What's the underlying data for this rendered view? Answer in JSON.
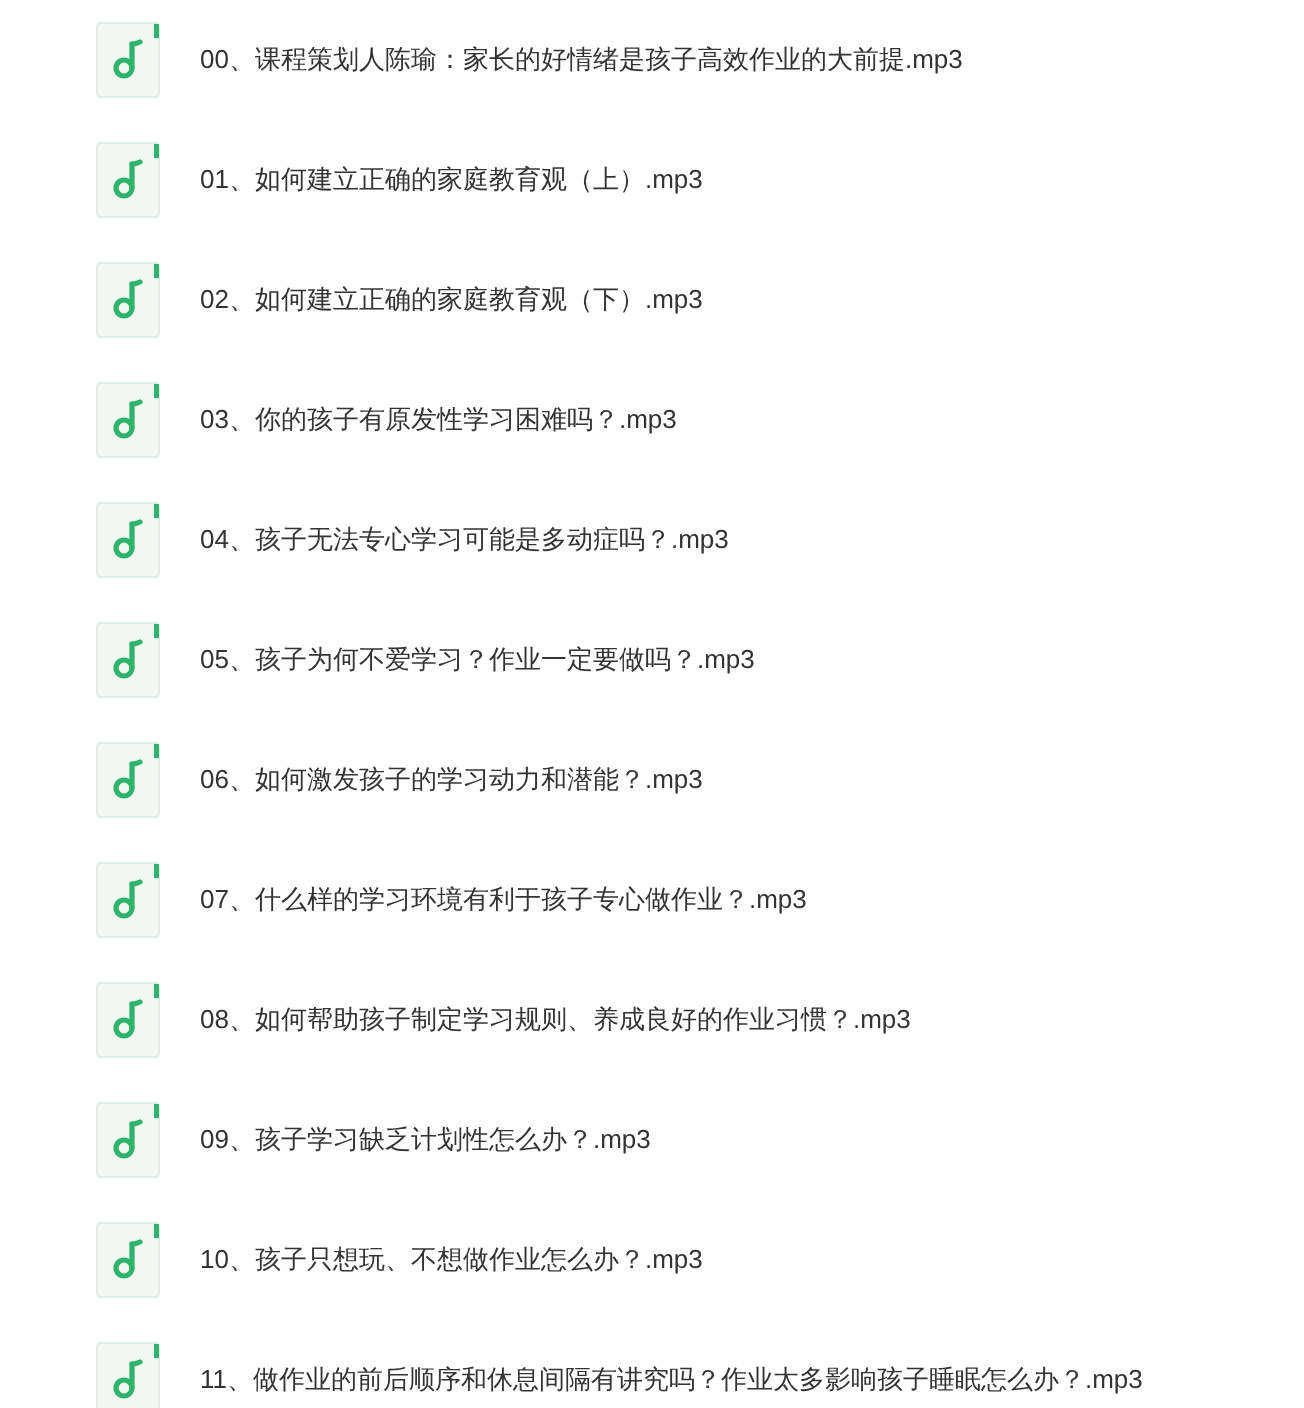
{
  "files": [
    {
      "name": "00、课程策划人陈瑜：家长的好情绪是孩子高效作业的大前提.mp3"
    },
    {
      "name": "01、如何建立正确的家庭教育观（上）.mp3"
    },
    {
      "name": "02、如何建立正确的家庭教育观（下）.mp3"
    },
    {
      "name": "03、你的孩子有原发性学习困难吗？.mp3"
    },
    {
      "name": "04、孩子无法专心学习可能是多动症吗？.mp3"
    },
    {
      "name": "05、孩子为何不爱学习？作业一定要做吗？.mp3"
    },
    {
      "name": "06、如何激发孩子的学习动力和潜能？.mp3"
    },
    {
      "name": "07、什么样的学习环境有利于孩子专心做作业？.mp3"
    },
    {
      "name": "08、如何帮助孩子制定学习规则、养成良好的作业习惯？.mp3"
    },
    {
      "name": "09、孩子学习缺乏计划性怎么办？.mp3"
    },
    {
      "name": "10、孩子只想玩、不想做作业怎么办？.mp3"
    },
    {
      "name": "11、做作业的前后顺序和休息间隔有讲究吗？作业太多影响孩子睡眠怎么办？.mp3"
    }
  ]
}
